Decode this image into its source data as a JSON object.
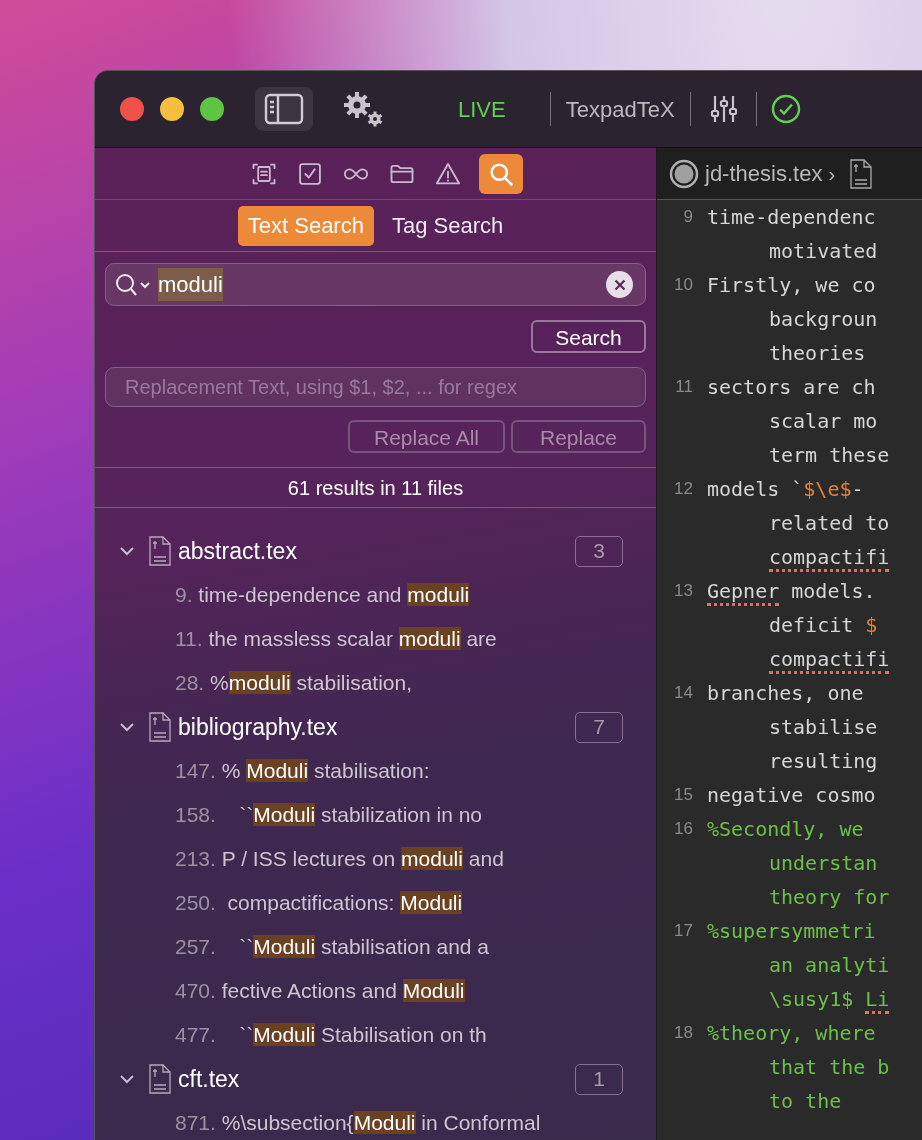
{
  "titlebar": {
    "live_label": "LIVE",
    "engine": "TexpadTeX",
    "build_ok": true
  },
  "toolbar": {
    "tools": [
      {
        "kind": "outline",
        "selected": false
      },
      {
        "kind": "tasks",
        "selected": false
      },
      {
        "kind": "links",
        "selected": false
      },
      {
        "kind": "files",
        "selected": false
      },
      {
        "kind": "issues",
        "selected": false
      },
      {
        "kind": "search",
        "selected": true
      }
    ]
  },
  "tabs": [
    {
      "label": "Text Search",
      "selected": true
    },
    {
      "label": "Tag Search",
      "selected": false
    }
  ],
  "search": {
    "value": "moduli",
    "button": "Search"
  },
  "replace": {
    "placeholder": "Replacement Text, using $1, $2, ... for regex",
    "buttons": [
      "Replace All",
      "Replace"
    ]
  },
  "summary": "61 results in 11 files",
  "files": [
    {
      "name": "abstract.tex",
      "count": "3",
      "expanded": true,
      "results": [
        {
          "line": "9.",
          "before": "time-dependence and ",
          "match": "moduli"
        },
        {
          "line": "11.",
          "before": "the massless scalar ",
          "match": "moduli",
          "after": " are"
        },
        {
          "line": "28.",
          "before": "%",
          "match": "moduli",
          "after": " stabilisation,"
        }
      ]
    },
    {
      "name": "bibliography.tex",
      "count": "7",
      "expanded": true,
      "results": [
        {
          "line": "147.",
          "before": "% ",
          "match": "Moduli",
          "after": " stabilisation:"
        },
        {
          "line": "158.",
          "before": "   ``",
          "match": "Moduli",
          "after": " stabilization in no"
        },
        {
          "line": "213.",
          "before": "P / ISS lectures on ",
          "match": "moduli",
          "after": " and"
        },
        {
          "line": "250.",
          "before": " compactifications: ",
          "match": "Moduli"
        },
        {
          "line": "257.",
          "before": "   ``",
          "match": "Moduli",
          "after": " stabilisation and a"
        },
        {
          "line": "470.",
          "before": "fective Actions and ",
          "match": "Moduli"
        },
        {
          "line": "477.",
          "before": "   ``",
          "match": "Moduli",
          "after": " Stabilisation on th"
        }
      ]
    },
    {
      "name": "cft.tex",
      "count": "1",
      "expanded": true,
      "results": [
        {
          "line": "871.",
          "before": "%\\subsection{",
          "match": "Moduli",
          "after": " in Conformal"
        }
      ]
    }
  ],
  "editor": {
    "file": "jd-thesis.tex",
    "separator": "›",
    "lines": [
      {
        "number": "9",
        "segments": [
          {
            "text": "time-dependenc",
            "kind": "plain",
            "misspelled": false
          }
        ]
      },
      {
        "segments": [
          {
            "text": "motivated",
            "kind": "plain",
            "misspelled": false
          }
        ]
      },
      {
        "number": "10",
        "segments": [
          {
            "text": "Firstly, we co",
            "kind": "plain",
            "misspelled": false
          }
        ]
      },
      {
        "segments": [
          {
            "text": "backgroun",
            "kind": "plain",
            "misspelled": false
          }
        ]
      },
      {
        "segments": [
          {
            "text": "theories",
            "kind": "plain",
            "misspelled": false
          }
        ]
      },
      {
        "number": "11",
        "segments": [
          {
            "text": "sectors are ch",
            "kind": "plain",
            "misspelled": false
          }
        ]
      },
      {
        "segments": [
          {
            "text": "scalar mo",
            "kind": "plain",
            "misspelled": false
          }
        ]
      },
      {
        "segments": [
          {
            "text": "term these",
            "kind": "plain",
            "misspelled": false
          }
        ]
      },
      {
        "number": "12",
        "segments": [
          {
            "text": "models `",
            "kind": "plain",
            "misspelled": false
          },
          {
            "text": "$\\e$",
            "kind": "math",
            "misspelled": false
          },
          {
            "text": "-",
            "kind": "plain",
            "misspelled": false
          }
        ]
      },
      {
        "segments": [
          {
            "text": "related to",
            "kind": "plain",
            "misspelled": false
          }
        ]
      },
      {
        "segments": [
          {
            "text": "compactifi",
            "kind": "plain",
            "misspelled": true
          }
        ]
      },
      {
        "number": "13",
        "segments": [
          {
            "text": "Gepner",
            "kind": "plain",
            "misspelled": true
          },
          {
            "text": " models.",
            "kind": "plain",
            "misspelled": false
          }
        ]
      },
      {
        "segments": [
          {
            "text": "deficit ",
            "kind": "plain",
            "misspelled": false
          },
          {
            "text": "$",
            "kind": "math",
            "misspelled": false
          }
        ]
      },
      {
        "segments": [
          {
            "text": "compactifi",
            "kind": "plain",
            "misspelled": true
          }
        ]
      },
      {
        "number": "14",
        "segments": [
          {
            "text": "branches, one",
            "kind": "plain",
            "misspelled": false
          }
        ]
      },
      {
        "segments": [
          {
            "text": "stabilise",
            "kind": "plain",
            "misspelled": false
          }
        ]
      },
      {
        "segments": [
          {
            "text": "resulting",
            "kind": "plain",
            "misspelled": false
          }
        ]
      },
      {
        "number": "15",
        "segments": [
          {
            "text": "negative cosmo",
            "kind": "plain",
            "misspelled": false
          }
        ]
      },
      {
        "number": "16",
        "segments": [
          {
            "text": "%Secondly, we",
            "kind": "comment",
            "misspelled": false
          }
        ]
      },
      {
        "segments": [
          {
            "text": "understan",
            "kind": "comment",
            "misspelled": false
          }
        ]
      },
      {
        "segments": [
          {
            "text": "theory for",
            "kind": "comment",
            "misspelled": false
          }
        ]
      },
      {
        "number": "17",
        "segments": [
          {
            "text": "%supersymmetri",
            "kind": "comment",
            "misspelled": false
          }
        ]
      },
      {
        "segments": [
          {
            "text": "an analyti",
            "kind": "comment",
            "misspelled": false
          }
        ]
      },
      {
        "segments": [
          {
            "text": "\\susy1$ ",
            "kind": "comment",
            "misspelled": false
          },
          {
            "text": "Li",
            "kind": "comment",
            "misspelled": true
          }
        ]
      },
      {
        "number": "18",
        "segments": [
          {
            "text": "%theory, where",
            "kind": "comment",
            "misspelled": false
          }
        ]
      },
      {
        "segments": [
          {
            "text": "that the b",
            "kind": "comment",
            "misspelled": false
          }
        ]
      },
      {
        "segments": [
          {
            "text": "to the",
            "kind": "comment",
            "misspelled": false
          }
        ]
      }
    ]
  }
}
